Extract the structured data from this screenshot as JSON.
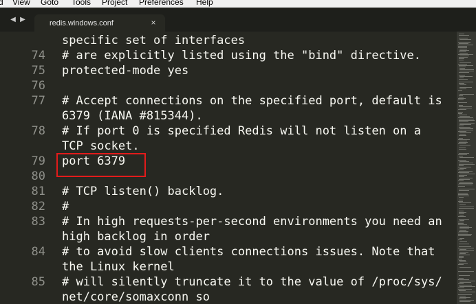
{
  "menu": [
    "d",
    "View",
    "Goto",
    "Tools",
    "Project",
    "Preferences",
    "Help"
  ],
  "tab": {
    "filename": "redis.windows.conf",
    "close_glyph": "×"
  },
  "nav": {
    "back": "◀",
    "forward": "▶"
  },
  "highlight": {
    "color": "#e31b1b"
  },
  "lines": [
    {
      "num": "",
      "text": "specific set of interfaces"
    },
    {
      "num": "74",
      "text": "# are explicitly listed using the \"bind\" directive."
    },
    {
      "num": "75",
      "text": "protected-mode yes"
    },
    {
      "num": "76",
      "text": ""
    },
    {
      "num": "77",
      "text": "# Accept connections on the specified port, default is"
    },
    {
      "num": "",
      "text": "6379 (IANA #815344)."
    },
    {
      "num": "78",
      "text": "# If port 0 is specified Redis will not listen on a"
    },
    {
      "num": "",
      "text": "TCP socket."
    },
    {
      "num": "79",
      "text": "port 6379"
    },
    {
      "num": "80",
      "text": ""
    },
    {
      "num": "81",
      "text": "# TCP listen() backlog."
    },
    {
      "num": "82",
      "text": "#"
    },
    {
      "num": "83",
      "text": "# In high requests-per-second environments you need an"
    },
    {
      "num": "",
      "text": "high backlog in order"
    },
    {
      "num": "84",
      "text": "# to avoid slow clients connections issues. Note that"
    },
    {
      "num": "",
      "text": "the Linux kernel"
    },
    {
      "num": "85",
      "text": "# will silently truncate it to the value of /proc/sys/"
    },
    {
      "num": "",
      "text": "net/core/somaxconn so"
    }
  ]
}
